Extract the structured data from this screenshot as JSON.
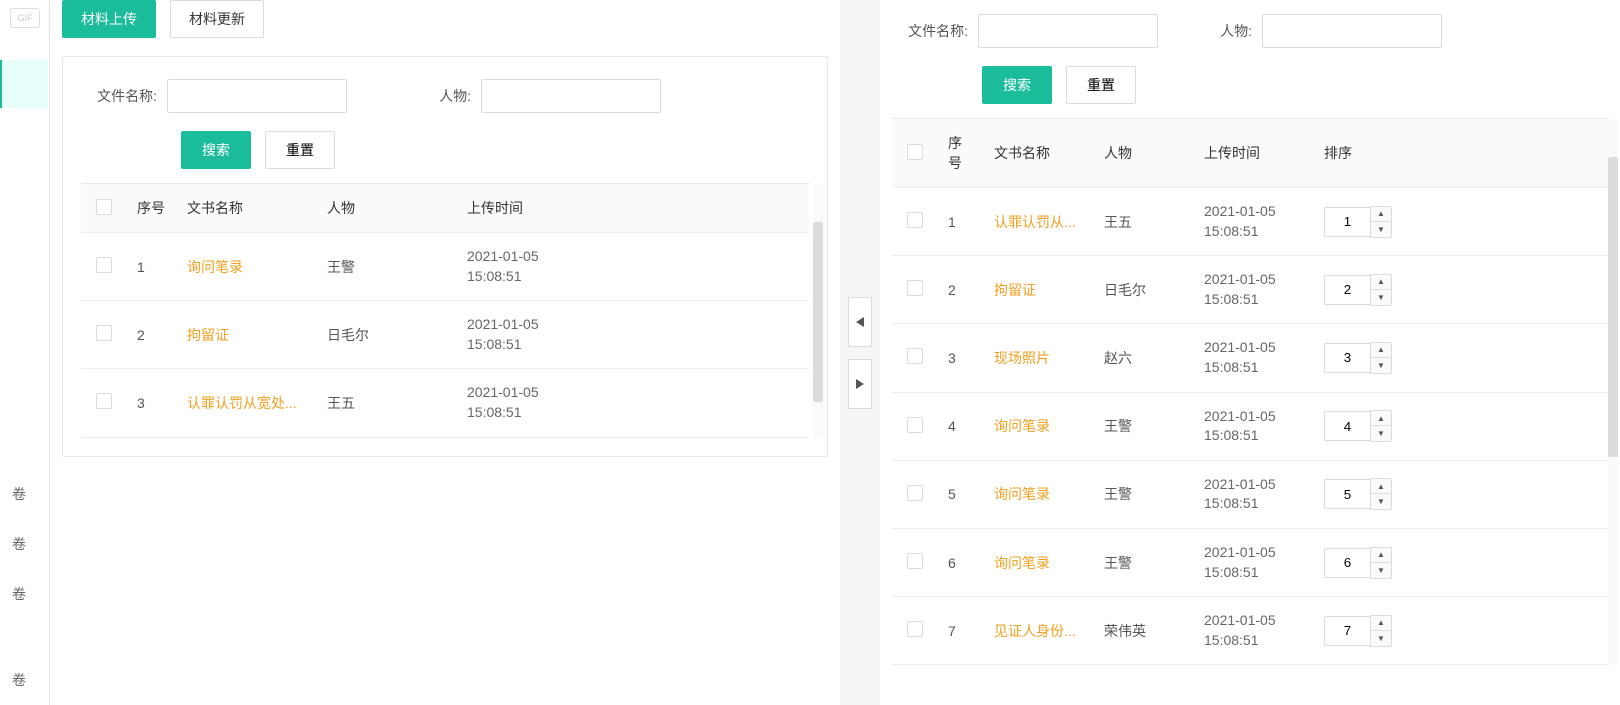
{
  "tabs": {
    "t1": "材料上传",
    "t2": "材料更新"
  },
  "left": {
    "labels": {
      "filename": "文件名称:",
      "person": "人物:"
    },
    "btns": {
      "search": "搜索",
      "reset": "重置"
    },
    "headers": {
      "seq": "序号",
      "doc": "文书名称",
      "person": "人物",
      "time": "上传时间"
    },
    "rows": [
      {
        "seq": "1",
        "doc": "询问笔录",
        "person": "王警",
        "time": "2021-01-05 15:08:51"
      },
      {
        "seq": "2",
        "doc": "拘留证",
        "person": "日毛尔",
        "time": "2021-01-05 15:08:51"
      },
      {
        "seq": "3",
        "doc": "认罪认罚从宽处...",
        "person": "王五",
        "time": "2021-01-05 15:08:51"
      }
    ]
  },
  "right": {
    "labels": {
      "filename": "文件名称:",
      "person": "人物:"
    },
    "btns": {
      "search": "搜索",
      "reset": "重置"
    },
    "headers": {
      "seq": "序号",
      "doc": "文书名称",
      "person": "人物",
      "time": "上传时间",
      "sort": "排序"
    },
    "rows": [
      {
        "seq": "1",
        "doc": "认罪认罚从...",
        "person": "王五",
        "time": "2021-01-05 15:08:51",
        "sort": "1"
      },
      {
        "seq": "2",
        "doc": "拘留证",
        "person": "日毛尔",
        "time": "2021-01-05 15:08:51",
        "sort": "2"
      },
      {
        "seq": "3",
        "doc": "现场照片",
        "person": "赵六",
        "time": "2021-01-05 15:08:51",
        "sort": "3"
      },
      {
        "seq": "4",
        "doc": "询问笔录",
        "person": "王警",
        "time": "2021-01-05 15:08:51",
        "sort": "4"
      },
      {
        "seq": "5",
        "doc": "询问笔录",
        "person": "王警",
        "time": "2021-01-05 15:08:51",
        "sort": "5"
      },
      {
        "seq": "6",
        "doc": "询问笔录",
        "person": "王警",
        "time": "2021-01-05 15:08:51",
        "sort": "6"
      },
      {
        "seq": "7",
        "doc": "见证人身份...",
        "person": "荣伟英",
        "time": "2021-01-05 15:08:51",
        "sort": "7"
      }
    ]
  },
  "sidebar": {
    "badge": "GIF",
    "c1": "卷",
    "c2": "卷",
    "c3": "卷",
    "c4": "卷"
  }
}
